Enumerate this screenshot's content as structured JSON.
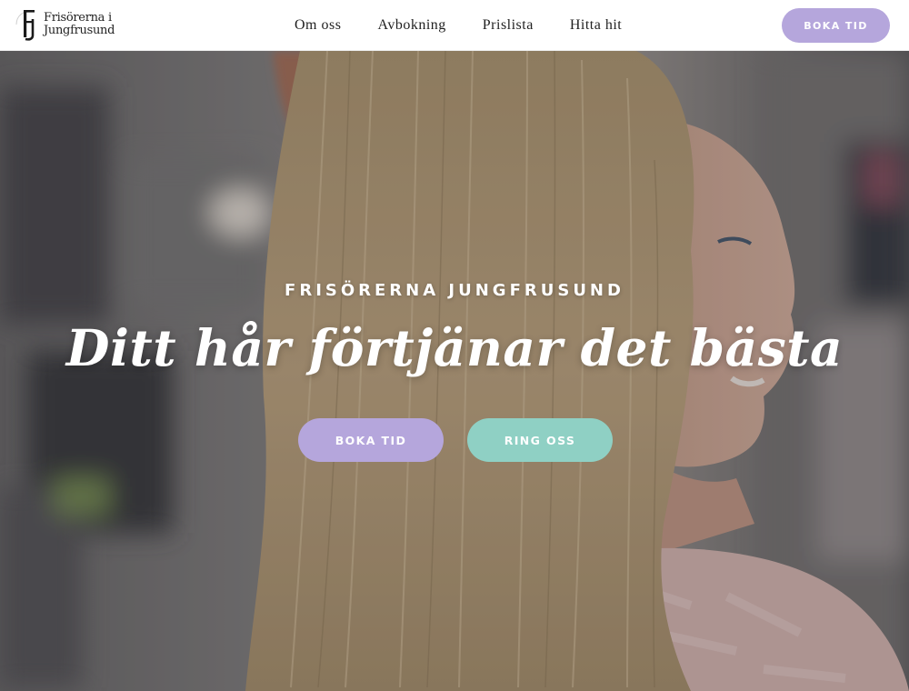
{
  "header": {
    "logo": {
      "line1": "Frisörerna i",
      "line2": "Jungfrusund",
      "icon": "fj-monogram-icon"
    },
    "nav": [
      {
        "label": "Om oss"
      },
      {
        "label": "Avbokning"
      },
      {
        "label": "Prislista"
      },
      {
        "label": "Hitta hit"
      }
    ],
    "cta_label": "BOKA TID"
  },
  "hero": {
    "kicker": "FRISÖRERNA JUNGFRUSUND",
    "headline_regular": "Ditt hår förtjänar ",
    "headline_bold": "det bästa",
    "primary_label": "BOKA TID",
    "secondary_label": "RING OSS",
    "image": "blonde-woman-hair-salon-photo"
  },
  "colors": {
    "lavender": "#b5a6dc",
    "mint": "#8fd0c4",
    "text": "#1f1f1f",
    "white": "#ffffff"
  }
}
